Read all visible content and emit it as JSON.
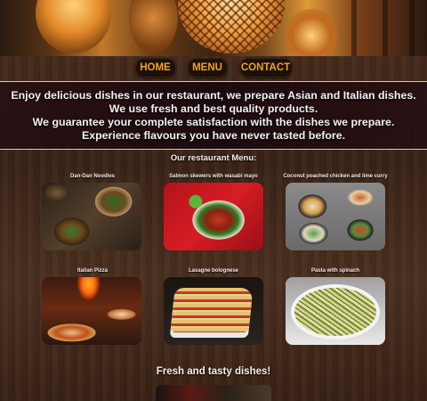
{
  "nav": {
    "home": "HOME",
    "menu": "MENU",
    "contact": "CONTACT"
  },
  "intro": {
    "line1": "Enjoy delicious dishes in our restaurant, we prepare Asian and Italian dishes.",
    "line2": "We use fresh and best quality products.",
    "line3": "We guarantee your complete satisfaction with the dishes we prepare.",
    "line4": "Experience flavours you have never tasted before."
  },
  "menu_title": "Our restaurant Menu:",
  "dishes": [
    {
      "name": "Dan-Dan Noodles"
    },
    {
      "name": "Salmon skewers with wasabi mayo"
    },
    {
      "name": "Coconut poached chicken and lime curry"
    },
    {
      "name": "Italian Pizza"
    },
    {
      "name": "Lasagne bolognese"
    },
    {
      "name": "Pasta with spinach"
    }
  ],
  "fresh_title": "Fresh and tasty dishes!",
  "colors": {
    "nav_text": "#f4a020",
    "nav_bg": "#1b1109",
    "banner_bg": "#1e0a0e",
    "text": "#f2f2f2"
  }
}
